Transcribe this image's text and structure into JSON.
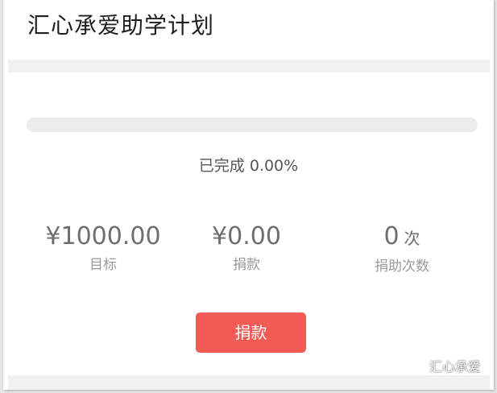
{
  "header": {
    "title": "汇心承爱助学计划"
  },
  "progress": {
    "percent": 0.0,
    "text": "已完成 0.00%",
    "color": "#f25a56"
  },
  "stats": {
    "target": {
      "value": "¥1000.00",
      "label": "目标"
    },
    "donated": {
      "value": "¥0.00",
      "label": "捐款"
    },
    "count": {
      "value": "0",
      "unit": "次",
      "label": "捐助次数"
    }
  },
  "actions": {
    "donate_label": "捐款",
    "accent": "#f25a56"
  },
  "watermark": {
    "icon": "wechat-icon",
    "text": "汇心承爱"
  }
}
